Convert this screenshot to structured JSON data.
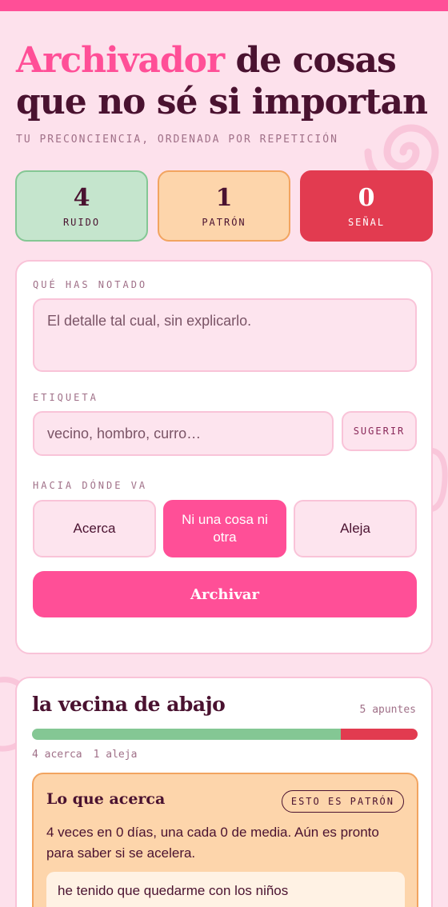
{
  "header": {
    "title_accent": "Archivador",
    "title_rest": " de cosas que no sé si importan",
    "subtitle": "TU PRECONCIENCIA, ORDENADA POR REPETICIÓN"
  },
  "stats": {
    "ruido": {
      "value": "4",
      "label": "RUIDO"
    },
    "patron": {
      "value": "1",
      "label": "PATRÓN"
    },
    "senal": {
      "value": "0",
      "label": "SEÑAL"
    }
  },
  "form": {
    "noticed_label": "QUÉ HAS NOTADO",
    "noticed_placeholder": "El detalle tal cual, sin explicarlo.",
    "tag_label": "ETIQUETA",
    "tag_placeholder": "vecino, hombro, curro…",
    "suggest_label": "SUGERIR",
    "direction_label": "HACIA DÓNDE VA",
    "directions": {
      "acerca": "Acerca",
      "ninguna": "Ni una cosa ni otra",
      "aleja": "Aleja"
    },
    "selected_direction": "Ni una cosa ni otra",
    "archive_label": "Archivar"
  },
  "entry": {
    "title": "la vecina de abajo",
    "count": "5 apuntes",
    "acerca_count": 4,
    "aleja_count": 1,
    "acerca_legend": "4 acerca",
    "aleja_legend": "1 aleja",
    "pattern": {
      "title": "Lo que acerca",
      "badge": "ESTO ES PATRÓN",
      "text": "4 veces en 0 días, una cada 0 de media. Aún es pronto para saber si se acelera.",
      "note": "he tenido que quedarme con los niños"
    }
  },
  "colors": {
    "accent": "#ff4f97",
    "ink": "#4a1230",
    "ruido": "#c5e5cd",
    "patron": "#fdd5ab",
    "senal": "#e23b50"
  }
}
